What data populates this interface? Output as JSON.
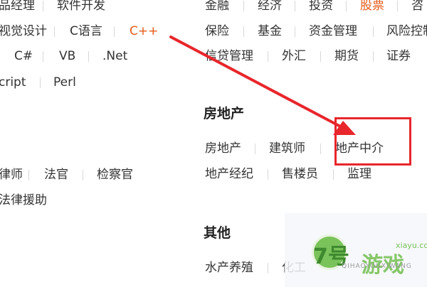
{
  "left_column": {
    "row1": [
      "品经理",
      "软件开发"
    ],
    "row2": [
      "视觉设计",
      "C语言",
      "C++"
    ],
    "row3": [
      "C#",
      "VB",
      ".Net"
    ],
    "row4": [
      "cript",
      "Perl"
    ],
    "row5": [
      "律师",
      "法官",
      "检察官"
    ],
    "row6": [
      "法律援助"
    ]
  },
  "right_column": {
    "row1": [
      "金融",
      "经济",
      "投资",
      "股票",
      "咨"
    ],
    "row2": [
      "保险",
      "基金",
      "资金管理",
      "风险控制"
    ],
    "row3": [
      "信贷管理",
      "外汇",
      "期货",
      "证券"
    ]
  },
  "real_estate": {
    "heading": "房地产",
    "row1": [
      "房地产",
      "建筑师",
      "地产中介"
    ],
    "row2": [
      "地产经纪",
      "售楼员",
      "监理"
    ]
  },
  "other": {
    "heading": "其他",
    "row1": [
      "水产养殖",
      "化工"
    ]
  },
  "watermark": {
    "brand": "7号",
    "brand_right": "游戏",
    "sub": "QIHAOYOUXIWANG",
    "small": "xiayu.com"
  },
  "colors": {
    "active": "#e55b18",
    "annotation": "#e8262b",
    "text": "#333333"
  },
  "active_item": "C++",
  "annotation_target": "地产中介"
}
